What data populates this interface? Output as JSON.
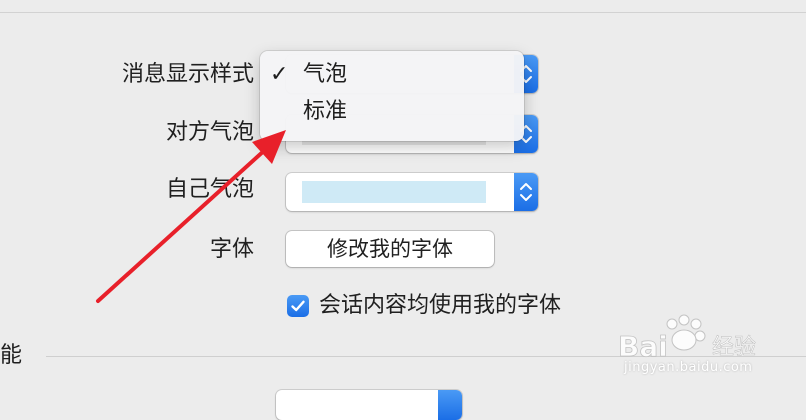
{
  "settings": {
    "message_style_label": "消息显示样式",
    "other_bubble_label": "对方气泡",
    "my_bubble_label": "自己气泡",
    "font_label": "字体",
    "change_font_button": "修改我的字体",
    "use_my_font_label": "会话内容均使用我的字体",
    "use_my_font_checked": true,
    "other_bubble_color": "#e9e9e9",
    "my_bubble_color": "#cfeaf6"
  },
  "menu": {
    "items": [
      {
        "label": "气泡",
        "checked": true,
        "mark": "✓"
      },
      {
        "label": "标准",
        "checked": false,
        "mark": ""
      }
    ]
  },
  "section": {
    "partial_label": "能"
  },
  "colors": {
    "accent": "#2f7ff0",
    "arrow": "#e8202a"
  },
  "watermark": {
    "logo_text": "Baidu经验",
    "url": "jingyan.baidu.com"
  }
}
